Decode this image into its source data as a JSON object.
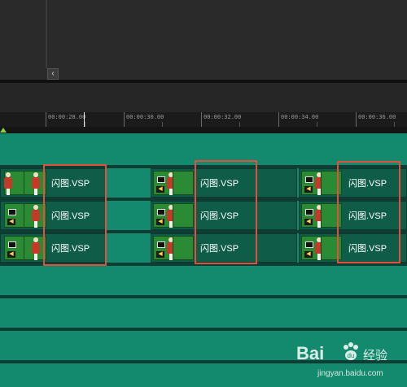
{
  "controls": {
    "scroll_left_glyph": "‹"
  },
  "ruler": {
    "timecodes": [
      "00:00:28.00",
      "00:00:30.00",
      "00:00:32.00",
      "00:00:34.00",
      "00:00:36.00"
    ]
  },
  "tracks": [
    {
      "clips": [
        "闪图.VSP",
        "闪图.VSP",
        "闪图.VSP"
      ]
    },
    {
      "clips": [
        "闪图.VSP",
        "闪图.VSP",
        "闪图.VSP"
      ]
    },
    {
      "clips": [
        "闪图.VSP",
        "闪图.VSP",
        "闪图.VSP"
      ]
    }
  ],
  "highlight_color": "#e0503c",
  "track_color": "#138a6e",
  "watermark": {
    "logo": "Bai",
    "logo_suffix": "du",
    "brand": "经验",
    "url": "jingyan.baidu.com"
  }
}
